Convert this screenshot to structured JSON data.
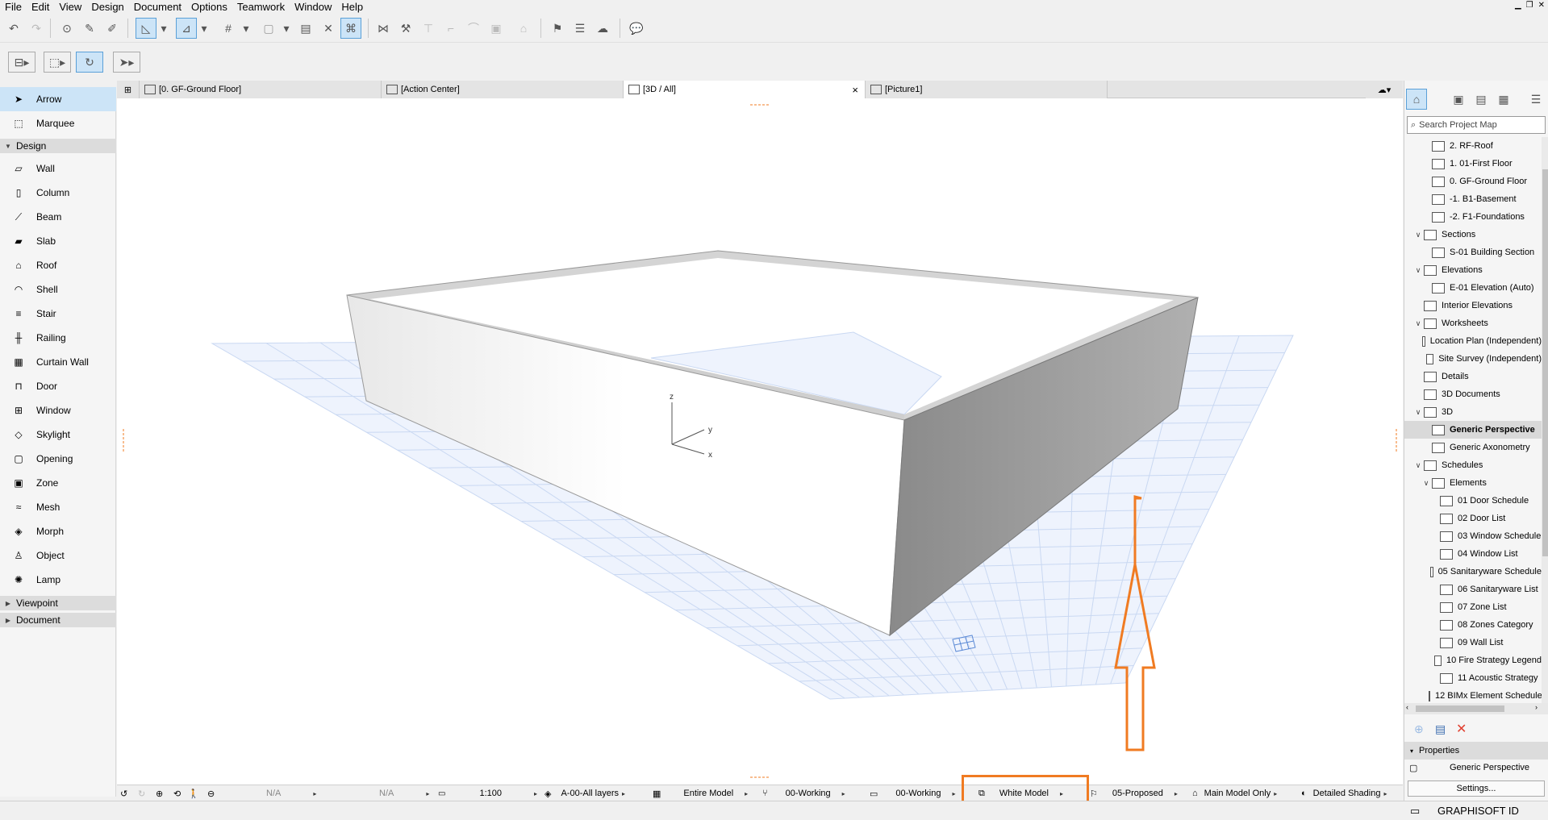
{
  "menu": [
    "File",
    "Edit",
    "View",
    "Design",
    "Document",
    "Options",
    "Teamwork",
    "Window",
    "Help"
  ],
  "toolbox": {
    "tools_top": [
      {
        "label": "Arrow",
        "icon": "arrow-icon",
        "selected": true
      },
      {
        "label": "Marquee",
        "icon": "marquee-icon",
        "selected": false
      }
    ],
    "design_header": "Design",
    "design_tools": [
      {
        "label": "Wall",
        "icon": "wall-icon"
      },
      {
        "label": "Column",
        "icon": "column-icon"
      },
      {
        "label": "Beam",
        "icon": "beam-icon"
      },
      {
        "label": "Slab",
        "icon": "slab-icon"
      },
      {
        "label": "Roof",
        "icon": "roof-icon"
      },
      {
        "label": "Shell",
        "icon": "shell-icon"
      },
      {
        "label": "Stair",
        "icon": "stair-icon"
      },
      {
        "label": "Railing",
        "icon": "railing-icon"
      },
      {
        "label": "Curtain Wall",
        "icon": "curtain-wall-icon"
      },
      {
        "label": "Door",
        "icon": "door-icon"
      },
      {
        "label": "Window",
        "icon": "window-icon"
      },
      {
        "label": "Skylight",
        "icon": "skylight-icon"
      },
      {
        "label": "Opening",
        "icon": "opening-icon"
      },
      {
        "label": "Zone",
        "icon": "zone-icon"
      },
      {
        "label": "Mesh",
        "icon": "mesh-icon"
      },
      {
        "label": "Morph",
        "icon": "morph-icon"
      },
      {
        "label": "Object",
        "icon": "object-icon"
      },
      {
        "label": "Lamp",
        "icon": "lamp-icon"
      }
    ],
    "viewpoint_header": "Viewpoint",
    "document_header": "Document"
  },
  "tabs": [
    {
      "label": "[0. GF-Ground Floor]",
      "active": false
    },
    {
      "label": "[Action Center]",
      "active": false
    },
    {
      "label": "[3D / All]",
      "active": true,
      "close": "×"
    },
    {
      "label": "[Picture1]",
      "active": false
    }
  ],
  "viewport": {
    "axis_z": "z",
    "axis_y": "y",
    "axis_x": "x"
  },
  "statusbar": {
    "nav_na_1": "N/A",
    "nav_na_2": "N/A",
    "scale": "1:100",
    "layers": "A-00-All layers",
    "model_filter": "Entire Model",
    "dimension": "00-Working",
    "pen_set": "00-Working",
    "graphic_override": "White Model",
    "renovation": "05-Proposed",
    "model_view": "Main Model Only",
    "shading": "Detailed Shading"
  },
  "navigator": {
    "search_placeholder": "Search Project Map",
    "items": [
      {
        "label": "2. RF-Roof",
        "indent": 2,
        "chev": ""
      },
      {
        "label": "1. 01-First Floor",
        "indent": 2,
        "chev": ""
      },
      {
        "label": "0. GF-Ground Floor",
        "indent": 2,
        "chev": ""
      },
      {
        "label": "-1. B1-Basement",
        "indent": 2,
        "chev": ""
      },
      {
        "label": "-2. F1-Foundations",
        "indent": 2,
        "chev": ""
      },
      {
        "label": "Sections",
        "indent": 1,
        "chev": "∨"
      },
      {
        "label": "S-01 Building Section",
        "indent": 2,
        "chev": ""
      },
      {
        "label": "Elevations",
        "indent": 1,
        "chev": "∨"
      },
      {
        "label": "E-01 Elevation (Auto)",
        "indent": 2,
        "chev": ""
      },
      {
        "label": "Interior Elevations",
        "indent": 1,
        "chev": ""
      },
      {
        "label": "Worksheets",
        "indent": 1,
        "chev": "∨"
      },
      {
        "label": "Location Plan (Independent)",
        "indent": 2,
        "chev": ""
      },
      {
        "label": "Site Survey (Independent)",
        "indent": 2,
        "chev": ""
      },
      {
        "label": "Details",
        "indent": 1,
        "chev": ""
      },
      {
        "label": "3D Documents",
        "indent": 1,
        "chev": ""
      },
      {
        "label": "3D",
        "indent": 1,
        "chev": "∨"
      },
      {
        "label": "Generic Perspective",
        "indent": 2,
        "chev": "",
        "selected": true
      },
      {
        "label": "Generic Axonometry",
        "indent": 2,
        "chev": ""
      },
      {
        "label": "Schedules",
        "indent": 1,
        "chev": "∨"
      },
      {
        "label": "Elements",
        "indent": 2,
        "chev": "∨"
      },
      {
        "label": "01 Door Schedule",
        "indent": 3,
        "chev": ""
      },
      {
        "label": "02 Door List",
        "indent": 3,
        "chev": ""
      },
      {
        "label": "03 Window Schedule",
        "indent": 3,
        "chev": ""
      },
      {
        "label": "04 Window List",
        "indent": 3,
        "chev": ""
      },
      {
        "label": "05 Sanitaryware Schedule",
        "indent": 3,
        "chev": ""
      },
      {
        "label": "06 Sanitaryware List",
        "indent": 3,
        "chev": ""
      },
      {
        "label": "07 Zone List",
        "indent": 3,
        "chev": ""
      },
      {
        "label": "08 Zones Category",
        "indent": 3,
        "chev": ""
      },
      {
        "label": "09 Wall List",
        "indent": 3,
        "chev": ""
      },
      {
        "label": "10 Fire Strategy Legend",
        "indent": 3,
        "chev": ""
      },
      {
        "label": "11 Acoustic Strategy",
        "indent": 3,
        "chev": ""
      },
      {
        "label": "12 BIMx Element Schedule",
        "indent": 3,
        "chev": ""
      }
    ],
    "properties_header": "Properties",
    "properties_value": "Generic Perspective",
    "settings_label": "Settings..."
  },
  "bottom": {
    "graphisoft_id": "GRAPHISOFT ID"
  },
  "colors": {
    "accent": "#f07b22",
    "selection": "#cce4f7",
    "grid": "#c9d8f2"
  }
}
